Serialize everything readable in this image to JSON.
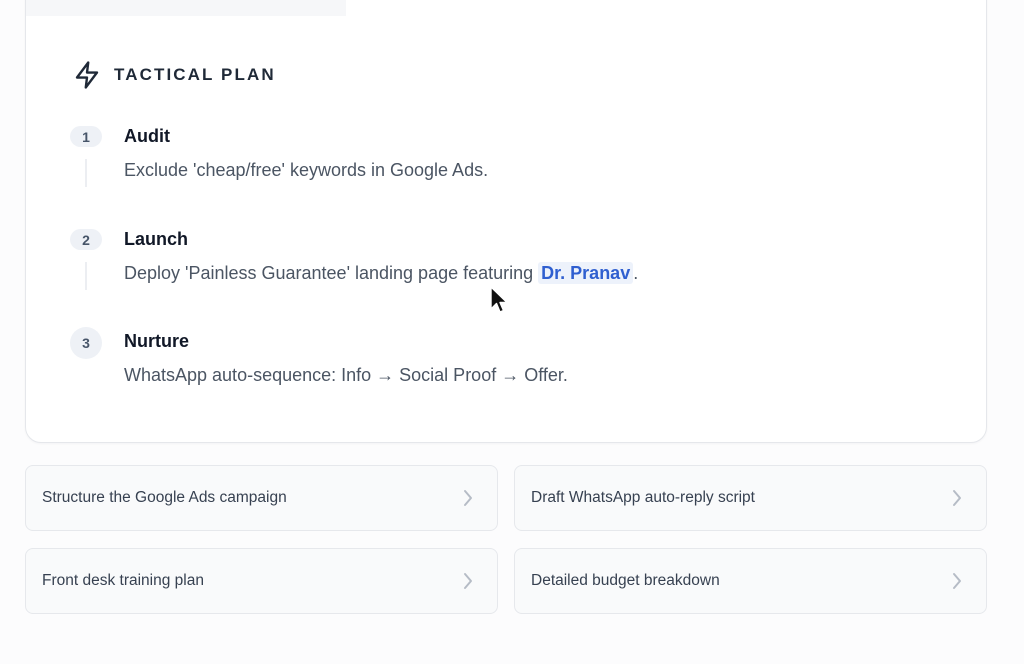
{
  "plan": {
    "title": "TACTICAL PLAN",
    "steps": [
      {
        "num": "1",
        "title": "Audit",
        "desc": "Exclude 'cheap/free' keywords in Google Ads."
      },
      {
        "num": "2",
        "title": "Launch",
        "desc_prefix": "Deploy 'Painless Guarantee' landing page featuring ",
        "highlight": "Dr. Pranav",
        "desc_suffix": "."
      },
      {
        "num": "3",
        "title": "Nurture",
        "desc": "WhatsApp auto-sequence: Info → Social Proof → Offer."
      }
    ]
  },
  "suggestions": [
    {
      "label": "Structure the Google Ads campaign"
    },
    {
      "label": "Draft WhatsApp auto-reply script"
    },
    {
      "label": "Front desk training plan"
    },
    {
      "label": "Detailed budget breakdown"
    }
  ],
  "icons": {
    "header": "lightning-bolt-icon",
    "suggestion": "chevron-right-icon"
  },
  "colors": {
    "highlight_text": "#2f5fd0",
    "highlight_bg": "#edf2fb"
  }
}
